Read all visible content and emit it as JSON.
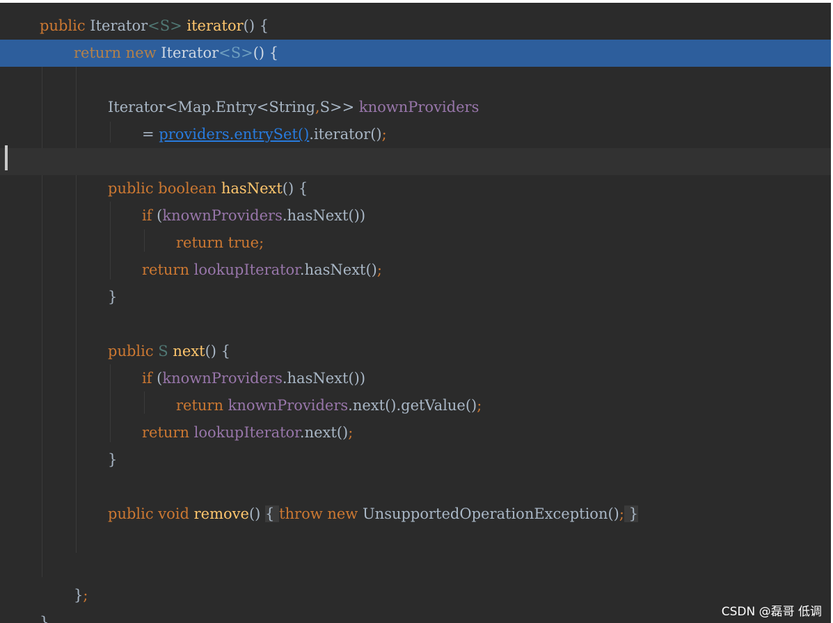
{
  "editor": {
    "theme_colors": {
      "background": "#2b2b2b",
      "selection": "#2d5e9c",
      "caret_line": "#323232",
      "keyword": "#cc7832",
      "field": "#9876aa",
      "method": "#ffc66d",
      "type_param": "#507874",
      "link": "#287bde",
      "plain": "#a9b7c6"
    },
    "lines": [
      [
        {
          "t": "public ",
          "c": "kw"
        },
        {
          "t": "Iterator"
        },
        {
          "t": "<S>",
          "c": "tp"
        },
        {
          "t": " "
        },
        {
          "t": "iterator",
          "c": "fn"
        },
        {
          "t": "() {"
        }
      ],
      [
        {
          "t": "return new ",
          "c": "sel-text"
        },
        {
          "t": "Iterator",
          "c": "sel-type"
        },
        {
          "t": "<S>",
          "c": "sel-tp"
        },
        {
          "t": "() {",
          "c": "sel-type"
        }
      ],
      [],
      [
        {
          "t": "Iterator<Map.Entry<String"
        },
        {
          "t": ",",
          "c": "kw"
        },
        {
          "t": "S>> "
        },
        {
          "t": "knownProviders",
          "c": "fld"
        }
      ],
      [
        {
          "t": "= "
        },
        {
          "t": "providers.entrySet()",
          "c": "link"
        },
        {
          "t": ".iterator()"
        },
        {
          "t": ";",
          "c": "kw"
        }
      ],
      [],
      [
        {
          "t": "public boolean ",
          "c": "kw"
        },
        {
          "t": "hasNext",
          "c": "fn"
        },
        {
          "t": "() {"
        }
      ],
      [
        {
          "t": "if ",
          "c": "kw"
        },
        {
          "t": "("
        },
        {
          "t": "knownProviders",
          "c": "fld"
        },
        {
          "t": ".hasNext())"
        }
      ],
      [
        {
          "t": "return true;",
          "c": "kw"
        }
      ],
      [
        {
          "t": "return ",
          "c": "kw"
        },
        {
          "t": "lookupIterator",
          "c": "fld"
        },
        {
          "t": ".hasNext()"
        },
        {
          "t": ";",
          "c": "kw"
        }
      ],
      [
        {
          "t": "}"
        }
      ],
      [],
      [
        {
          "t": "public ",
          "c": "kw"
        },
        {
          "t": "S ",
          "c": "tp"
        },
        {
          "t": "next",
          "c": "fn"
        },
        {
          "t": "() {"
        }
      ],
      [
        {
          "t": "if ",
          "c": "kw"
        },
        {
          "t": "("
        },
        {
          "t": "knownProviders",
          "c": "fld"
        },
        {
          "t": ".hasNext())"
        }
      ],
      [
        {
          "t": "return ",
          "c": "kw"
        },
        {
          "t": "knownProviders",
          "c": "fld"
        },
        {
          "t": ".next().getValue()"
        },
        {
          "t": ";",
          "c": "kw"
        }
      ],
      [
        {
          "t": "return ",
          "c": "kw"
        },
        {
          "t": "lookupIterator",
          "c": "fld"
        },
        {
          "t": ".next()"
        },
        {
          "t": ";",
          "c": "kw"
        }
      ],
      [
        {
          "t": "}"
        }
      ],
      [],
      [
        {
          "t": "public void ",
          "c": "kw"
        },
        {
          "t": "remove",
          "c": "fn"
        },
        {
          "t": "() "
        },
        {
          "t": "{ ",
          "c": "brace-hl"
        },
        {
          "t": "throw new ",
          "c": "kw"
        },
        {
          "t": "UnsupportedOperationException()"
        },
        {
          "t": ";",
          "c": "kw"
        },
        {
          "t": " }",
          "c": "brace-hl"
        }
      ],
      [],
      [],
      [
        {
          "t": "}"
        },
        {
          "t": ";",
          "c": "kw"
        }
      ],
      [
        {
          "t": "}"
        }
      ]
    ]
  },
  "watermark": "CSDN @磊哥 低调"
}
